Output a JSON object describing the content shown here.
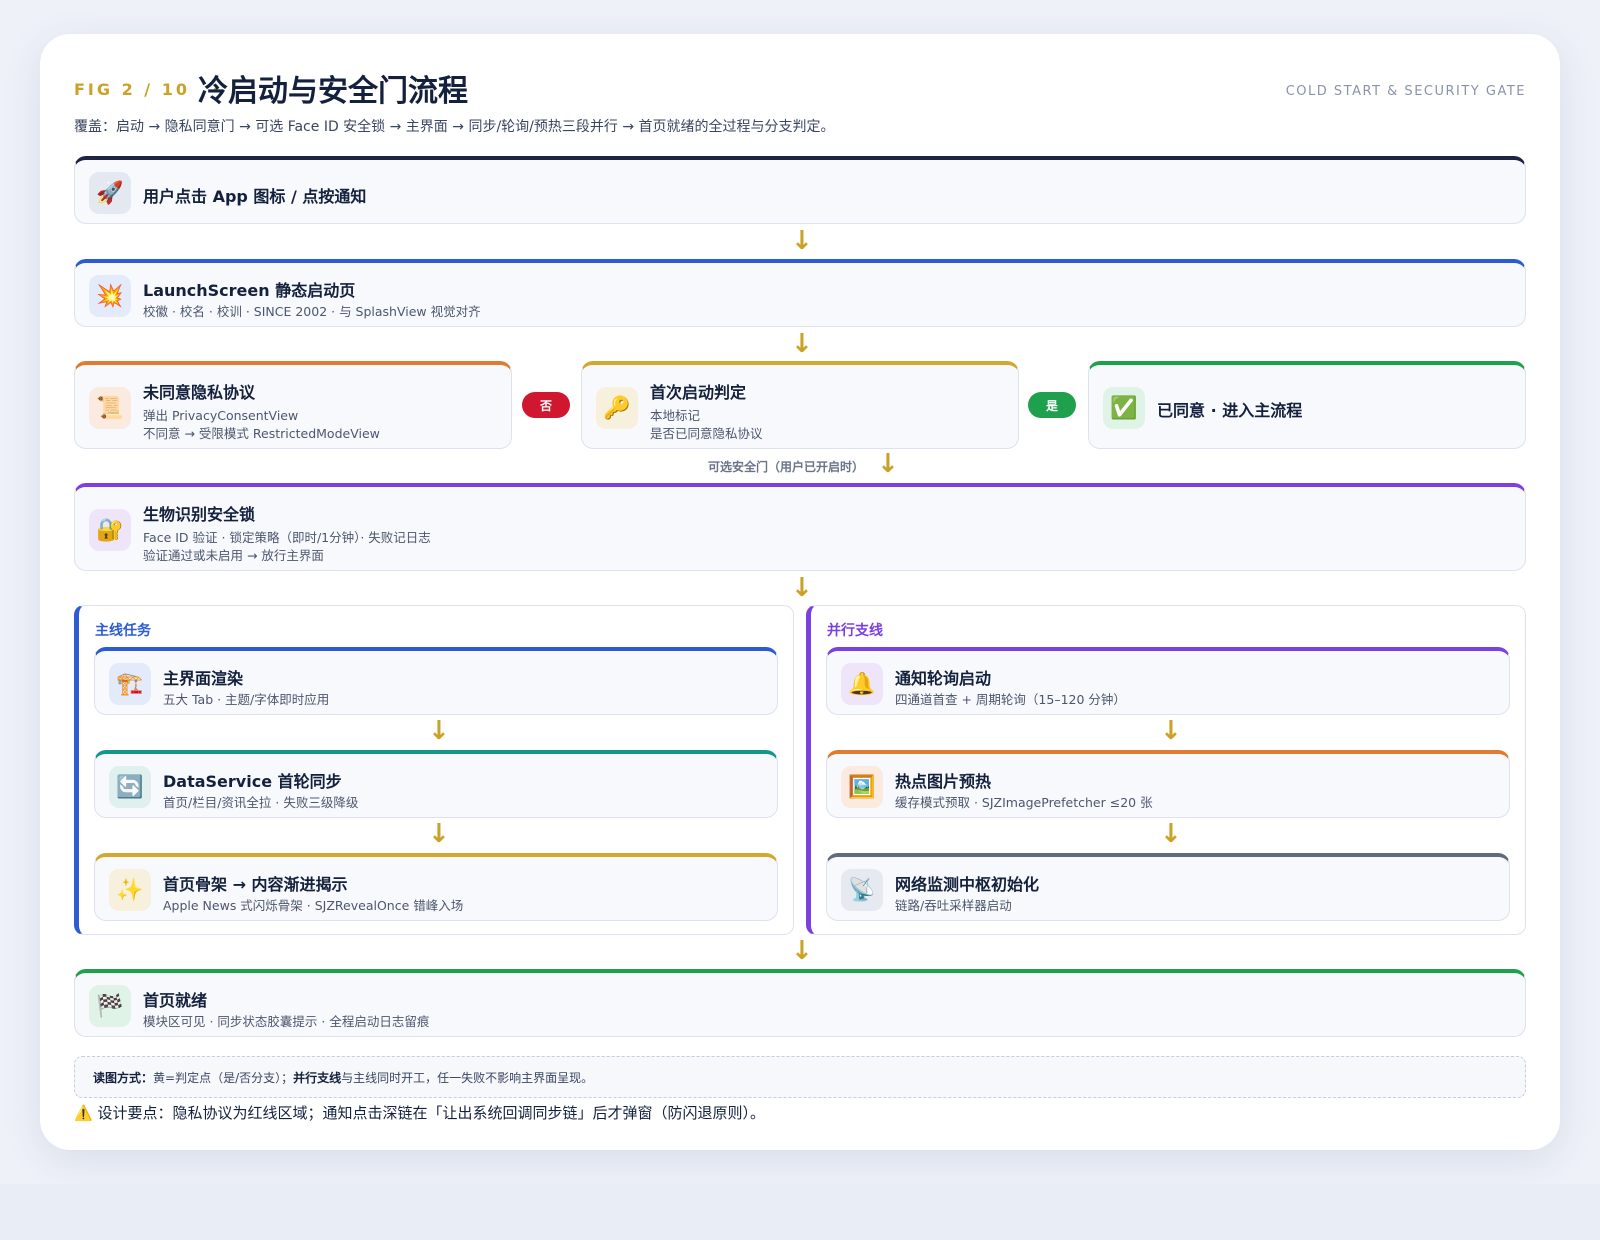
{
  "header": {
    "fig_no": "FIG 2 / 10",
    "separator": "·",
    "title": "冷启动与安全门流程",
    "subtitle_en": "COLD START & SECURITY GATE",
    "coverage": "覆盖：启动 → 隐私同意门 → 可选 Face ID 安全锁 → 主界面 → 同步/轮询/预热三段并行 → 首页就绪的全过程与分支判定。"
  },
  "colors": {
    "accent": "#c9a227",
    "navy": "#1c2544",
    "blue": "#2d5bd4",
    "orange": "#e07b32",
    "gold": "#d2a92e",
    "green": "#1fa04c",
    "purple": "#7c3fe0",
    "teal": "#15968a",
    "slate": "#5f6b80",
    "red": "#cf1730"
  },
  "nodes": {
    "tap": {
      "icon": "rocket-icon",
      "glyph": "🚀",
      "title": "用户点击 App 图标 / 点按通知"
    },
    "launch": {
      "icon": "sparkle-burst-icon",
      "glyph": "💥",
      "title": "LaunchScreen 静态启动页",
      "desc": "校徽 · 校名 · 校训 · SINCE 2002 · 与 SplashView 视觉对齐"
    },
    "privacy_no": {
      "icon": "scroll-icon",
      "glyph": "📜",
      "title": "未同意隐私协议",
      "desc1": "弹出 PrivacyConsentView",
      "desc2": "不同意 → 受限模式 RestrictedModeView"
    },
    "first_launch": {
      "icon": "key-icon",
      "glyph": "🔑",
      "title": "首次启动判定",
      "desc1": "本地标记",
      "desc2": "是否已同意隐私协议"
    },
    "agreed": {
      "icon": "check-mark-icon",
      "glyph": "✅",
      "title": "已同意 · 进入主流程"
    },
    "biometric": {
      "icon": "locked-with-key-icon",
      "glyph": "🔐",
      "title": "生物识别安全锁",
      "desc1": "Face ID 验证 · 锁定策略（即时/1分钟）· 失败记日志",
      "desc2": "验证通过或未启用 → 放行主界面"
    },
    "render": {
      "icon": "crane-icon",
      "glyph": "🏗️",
      "title": "主界面渲染",
      "desc": "五大 Tab · 主题/字体即时应用"
    },
    "sync": {
      "icon": "refresh-icon",
      "glyph": "🔄",
      "title": "DataService 首轮同步",
      "desc": "首页/栏目/资讯全拉 · 失败三级降级"
    },
    "skeleton": {
      "icon": "sparkles-icon",
      "glyph": "✨",
      "title": "首页骨架 → 内容渐进揭示",
      "desc": "Apple News 式闪烁骨架 · SJZRevealOnce 错峰入场"
    },
    "notify": {
      "icon": "bell-icon",
      "glyph": "🔔",
      "title": "通知轮询启动",
      "desc": "四通道首查 + 周期轮询（15–120 分钟）"
    },
    "prefetch": {
      "icon": "framed-picture-icon",
      "glyph": "🖼️",
      "title": "热点图片预热",
      "desc": "缓存模式预取 · SJZImagePrefetcher ≤20 张"
    },
    "network": {
      "icon": "satellite-antenna-icon",
      "glyph": "📡",
      "title": "网络监测中枢初始化",
      "desc": "链路/吞吐采样器启动"
    },
    "ready": {
      "icon": "chequered-flag-icon",
      "glyph": "🏁",
      "title": "首页就绪",
      "desc": "模块区可见 · 同步状态胶囊提示 · 全程启动日志留痕"
    }
  },
  "branches": {
    "no": "否",
    "yes": "是",
    "gate_label": "可选安全门（用户已开启时）"
  },
  "lanes": {
    "main": "主线任务",
    "parallel": "并行支线"
  },
  "arrow_glyph": "↓",
  "legend": {
    "label": "读图方式：",
    "text1": "黄=判定点（是/否分支）；",
    "bold2": "并行支线",
    "text2": "与主线同时开工，任一失败不影响主界面呈现。"
  },
  "note": {
    "icon": "warning-icon",
    "glyph": "⚠️",
    "text": "设计要点：隐私协议为红线区域；通知点击深链在「让出系统回调同步链」后才弹窗（防闪退原则）。"
  }
}
